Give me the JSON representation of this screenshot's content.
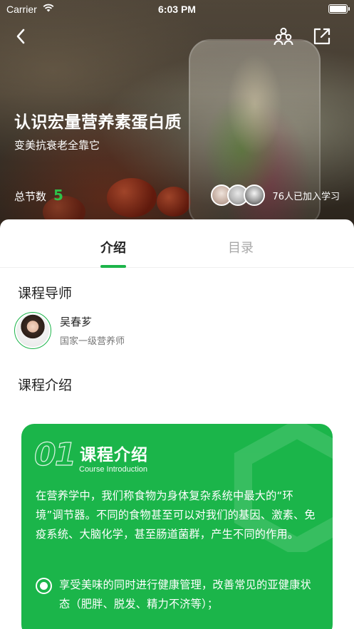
{
  "status_bar": {
    "carrier": "Carrier",
    "time": "6:03 PM"
  },
  "header": {
    "back_icon": "chevron-left-icon",
    "group_icon": "group-people-icon",
    "share_icon": "share-external-icon"
  },
  "course": {
    "title": "认识宏量营养素蛋白质",
    "subtitle": "变美抗衰老全靠它",
    "lessons_label": "总节数",
    "lessons_count": "5",
    "learners_text": "76人已加入学习"
  },
  "tabs": [
    {
      "label": "介绍",
      "active": true
    },
    {
      "label": "目录",
      "active": false
    }
  ],
  "instructor": {
    "section_title": "课程导师",
    "name": "吴春芗",
    "title": "国家一级营养师"
  },
  "intro": {
    "section_title": "课程介绍",
    "card": {
      "number": "01",
      "title": "课程介绍",
      "subtitle": "Course Introduction",
      "paragraph": "在营养学中，我们称食物为身体复杂系统中最大的“环境”调节器。不同的食物甚至可以对我们的基因、激素、免疫系统、大脑化学，甚至肠道菌群，产生不同的作用。",
      "bullet": "享受美味的同时进行健康管理，改善常见的亚健康状态（肥胖、脱发、精力不济等）；"
    }
  },
  "colors": {
    "accent": "#1cb44a",
    "card_bg": "#1bb54a",
    "lesson_count": "#2ec14a"
  }
}
